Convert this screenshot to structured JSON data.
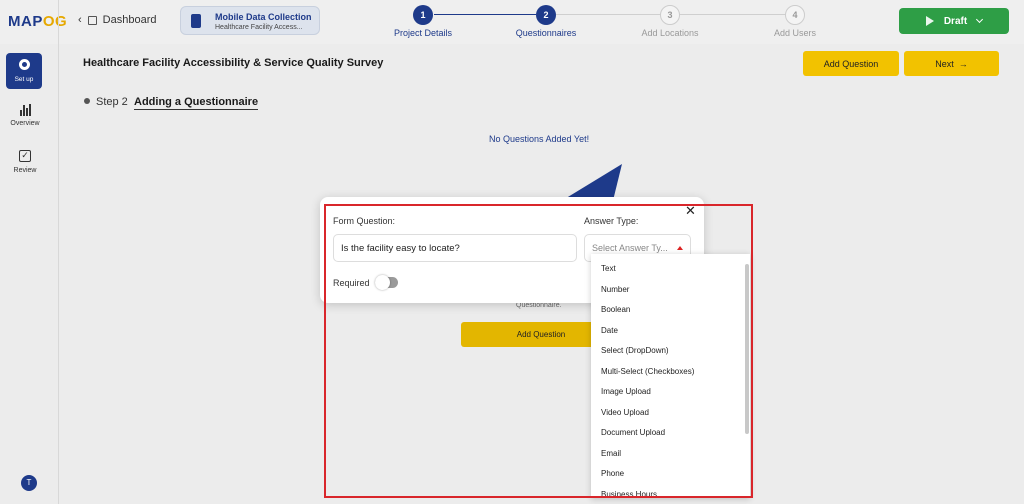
{
  "logo": {
    "prefix": "MAP",
    "accent": "OG"
  },
  "header": {
    "dashboard_label": "Dashboard",
    "project": {
      "title": "Mobile Data Collection",
      "subtitle": "Healthcare Facility Access..."
    },
    "steps": [
      {
        "num": "1",
        "label": "Project Details",
        "state": "done"
      },
      {
        "num": "2",
        "label": "Questionnaires",
        "state": "active"
      },
      {
        "num": "3",
        "label": "Add Locations",
        "state": "pending"
      },
      {
        "num": "4",
        "label": "Add Users",
        "state": "pending"
      }
    ],
    "draft_label": "Draft"
  },
  "sidebar": {
    "items": [
      {
        "label": "Set up",
        "icon": "gear-icon",
        "active": true
      },
      {
        "label": "Overview",
        "icon": "bar-chart-icon"
      },
      {
        "label": "Review",
        "icon": "checkbox-icon"
      }
    ],
    "avatar_initial": "T"
  },
  "main": {
    "survey_title": "Healthcare Facility Accessibility & Service Quality Survey",
    "add_question_label": "Add Question",
    "next_label": "Next",
    "step_number": "Step 2",
    "step_heading": "Adding a Questionnaire",
    "empty_message": "No Questions Added Yet!",
    "empty_subtext": "Questionnaire.",
    "empty_add_question_label": "Add Question"
  },
  "dialog": {
    "question_label": "Form Question:",
    "question_value": "Is the facility easy to locate?",
    "answer_type_label": "Answer Type:",
    "answer_type_placeholder": "Select Answer Ty...",
    "required_label": "Required",
    "required_on": false,
    "answer_options": [
      "Text",
      "Number",
      "Boolean",
      "Date",
      "Select (DropDown)",
      "Multi-Select (Checkboxes)",
      "Image Upload",
      "Video Upload",
      "Document Upload",
      "Email",
      "Phone",
      "Business Hours"
    ]
  },
  "colors": {
    "brand": "#1e3a8a",
    "accent": "#f2c200",
    "draft": "#2e9e46",
    "highlight": "#d9262b"
  }
}
